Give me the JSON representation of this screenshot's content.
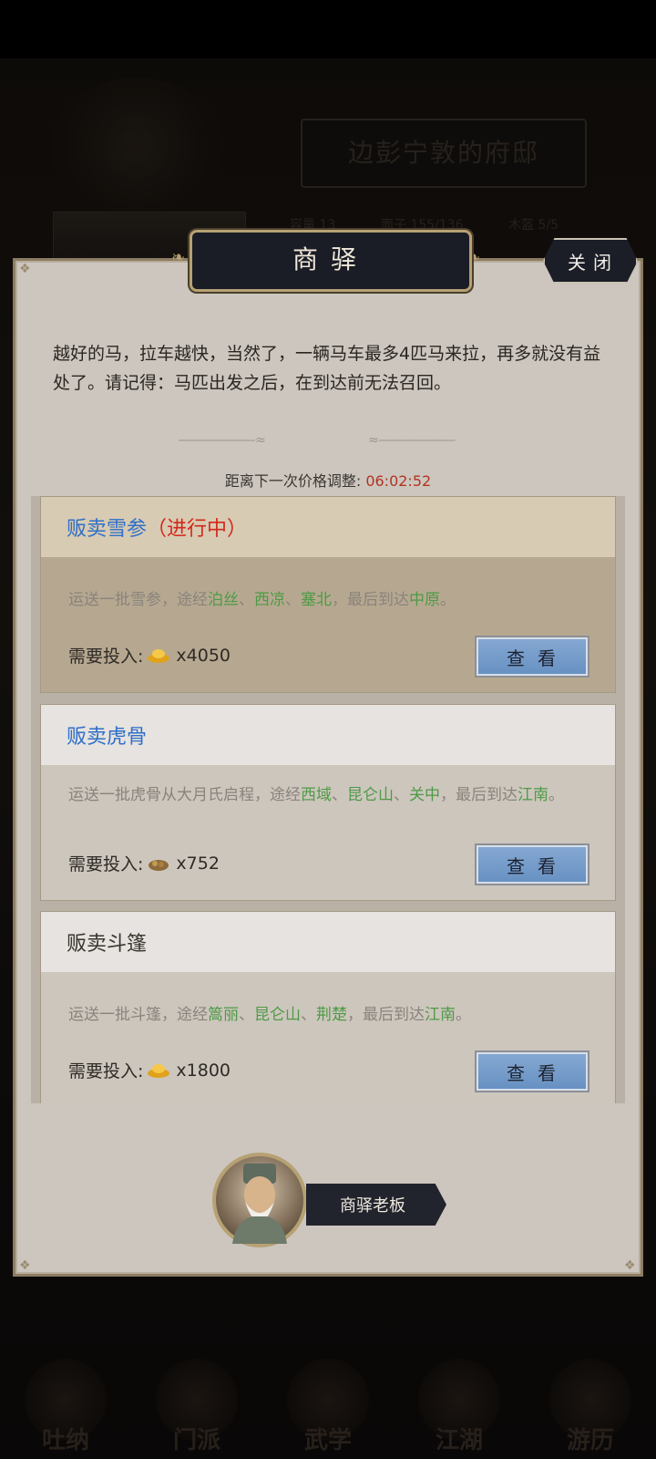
{
  "background": {
    "mansion_title": "边彭宁敦的府邸",
    "stats": [
      "容量 13",
      "面子 155/136",
      "木盔 5/5"
    ],
    "nav_items": [
      "吐纳",
      "门派",
      "武学",
      "江湖",
      "游历"
    ]
  },
  "dialog": {
    "title": "商驿",
    "close_label": "关闭",
    "description": "越好的马，拉车越快，当然了，一辆马车最多4匹马来拉，再多就没有益处了。请记得：马匹出发之后，在到达前无法召回。",
    "timer_label": "距离下一次价格调整:",
    "timer_value": "06:02:52",
    "npc_name": "商驿老板"
  },
  "cards": [
    {
      "title": "贩卖雪参",
      "status": "（进行中）",
      "route_parts": [
        {
          "text": "运送一批雪参，途经",
          "hl": false
        },
        {
          "text": "泊丝",
          "hl": true
        },
        {
          "text": "、",
          "hl": false
        },
        {
          "text": "西凉",
          "hl": true
        },
        {
          "text": "、",
          "hl": false
        },
        {
          "text": "塞北",
          "hl": true
        },
        {
          "text": "，最后到达",
          "hl": false
        },
        {
          "text": "中原",
          "hl": true
        },
        {
          "text": "。",
          "hl": false
        }
      ],
      "invest_label": "需要投入:",
      "invest_icon": "gold-ingot-icon",
      "invest_amount": "x4050",
      "button_label": "查看"
    },
    {
      "title": "贩卖虎骨",
      "status": "",
      "route_parts": [
        {
          "text": "运送一批虎骨从大月氏启程，途经",
          "hl": false
        },
        {
          "text": "西域",
          "hl": true
        },
        {
          "text": "、",
          "hl": false
        },
        {
          "text": "昆仑山",
          "hl": true
        },
        {
          "text": "、",
          "hl": false
        },
        {
          "text": "关中",
          "hl": true
        },
        {
          "text": "，最后到达",
          "hl": false
        },
        {
          "text": "江南",
          "hl": true
        },
        {
          "text": "。",
          "hl": false
        }
      ],
      "invest_label": "需要投入:",
      "invest_icon": "ore-icon",
      "invest_amount": "x752",
      "button_label": "查看"
    },
    {
      "title": "贩卖斗篷",
      "status": "",
      "route_parts": [
        {
          "text": "运送一批斗篷，途经",
          "hl": false
        },
        {
          "text": "篙丽",
          "hl": true
        },
        {
          "text": "、",
          "hl": false
        },
        {
          "text": "昆仑山",
          "hl": true
        },
        {
          "text": "、",
          "hl": false
        },
        {
          "text": "荆楚",
          "hl": true
        },
        {
          "text": "，最后到达",
          "hl": false
        },
        {
          "text": "江南",
          "hl": true
        },
        {
          "text": "。",
          "hl": false
        }
      ],
      "invest_label": "需要投入:",
      "invest_icon": "gold-ingot-icon",
      "invest_amount": "x1800",
      "button_label": "查看"
    }
  ],
  "colors": {
    "active_title": "#2f6fc8",
    "status": "#d4281c",
    "route_highlight": "#4e9a46",
    "timer": "#b2341f",
    "button": "#7b9fcc"
  }
}
